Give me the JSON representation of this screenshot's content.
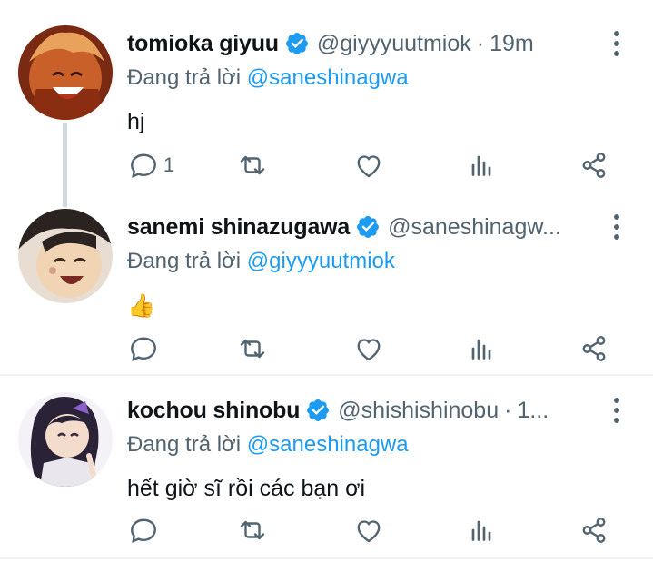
{
  "tweets": [
    {
      "name": "tomioka giyuu",
      "handle": "@giyyyuutmiok",
      "separator": "·",
      "time": "19m",
      "reply_prefix": "Đang trả lời",
      "reply_to": "@saneshinagwa",
      "text": "hj",
      "reply_count": "1",
      "avatar_color": "#c9602a"
    },
    {
      "name": "sanemi shinazugawa",
      "handle": "@saneshinagw...",
      "separator": "",
      "time": "",
      "reply_prefix": "Đang trả lời",
      "reply_to": "@giyyyuutmiok",
      "text": "👍",
      "reply_count": "",
      "avatar_color": "#f1d4b4"
    },
    {
      "name": "kochou shinobu",
      "handle": "@shishishinobu",
      "separator": "·",
      "time": "1...",
      "reply_prefix": "Đang trả lời",
      "reply_to": "@saneshinagwa",
      "text": "hết giờ sĩ rồi các bạn ơi",
      "reply_count": "",
      "avatar_color": "#3a2d4a"
    }
  ],
  "colors": {
    "accent": "#1d9bf0",
    "secondary_text": "#536471",
    "primary_text": "#0f1419",
    "divider": "#eff3f4"
  },
  "icons": {
    "verified": "verified-badge-icon",
    "reply": "reply-icon",
    "retweet": "retweet-icon",
    "like": "like-icon",
    "views": "views-icon",
    "share": "share-icon",
    "more": "more-options-icon"
  }
}
